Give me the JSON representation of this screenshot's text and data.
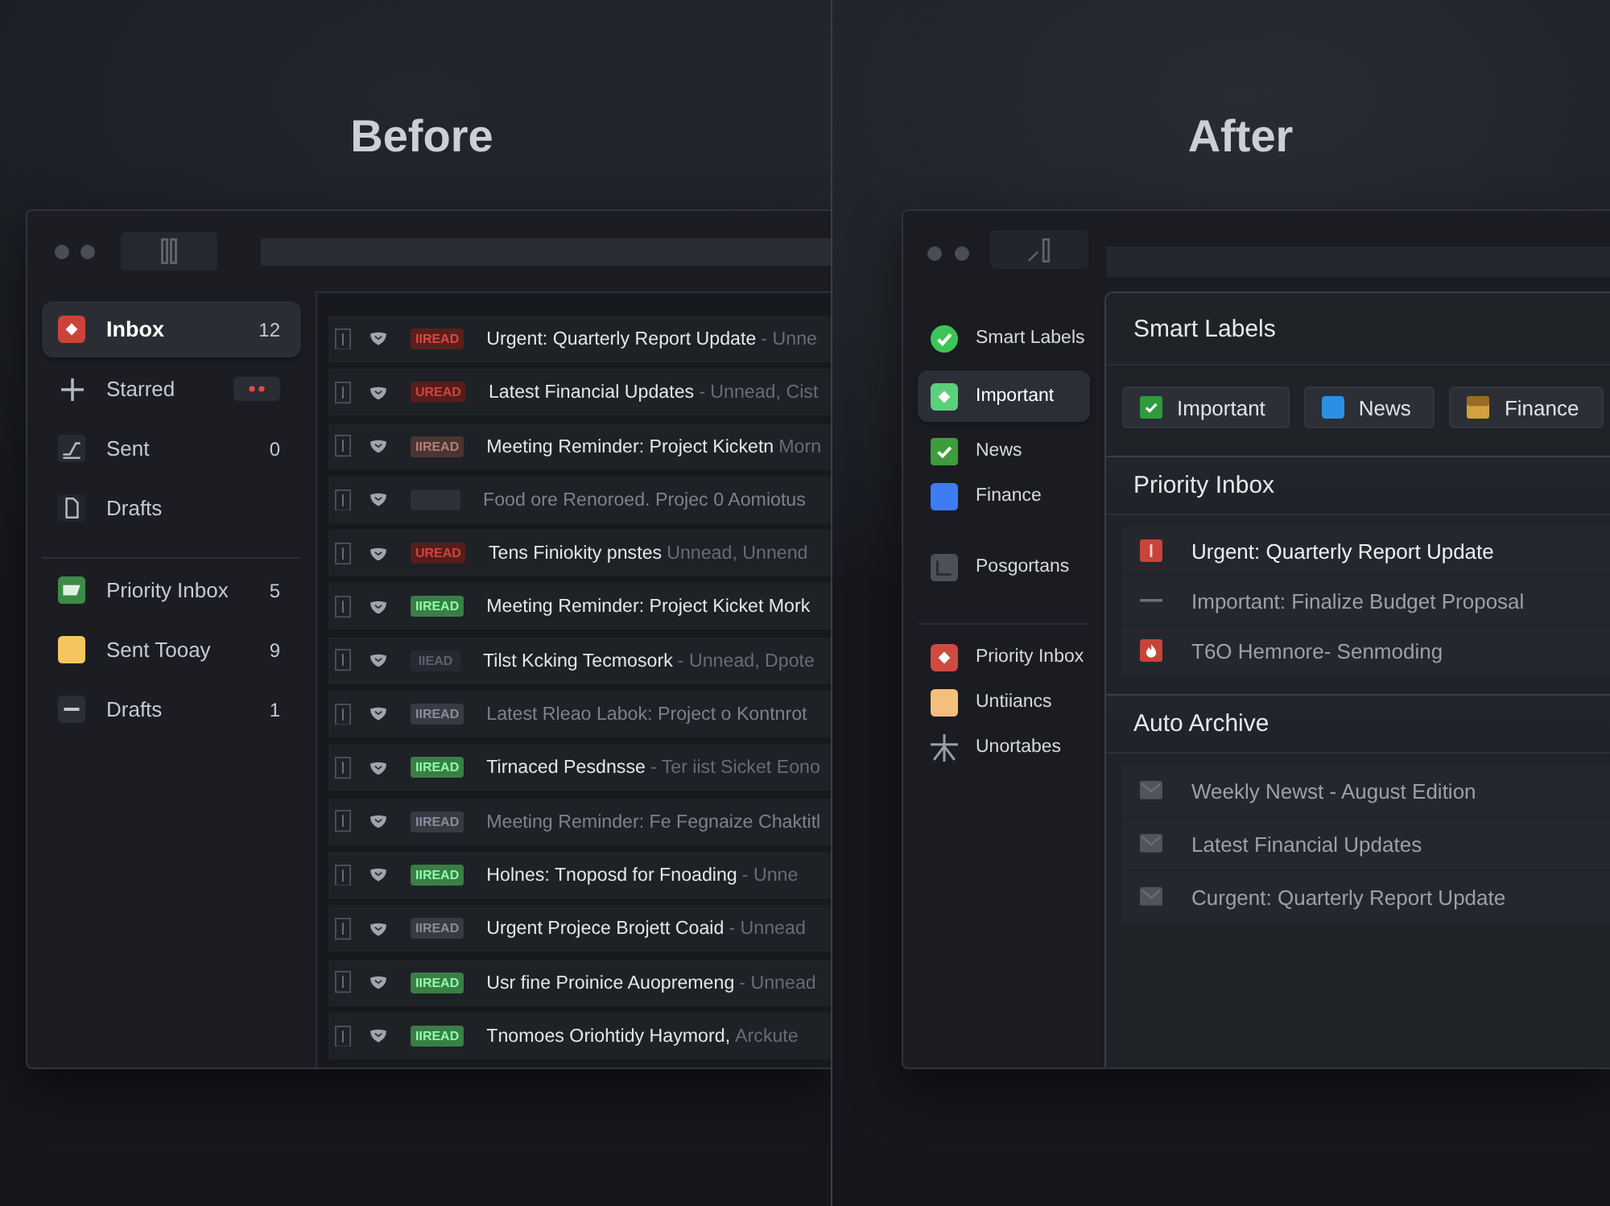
{
  "before": {
    "heading": "Before",
    "sidebar": {
      "folders": [
        {
          "label": "Inbox",
          "kind": "diamond",
          "count": "12",
          "marker": false,
          "selected": true
        },
        {
          "label": "Starred",
          "kind": "plus",
          "marker": true,
          "selected": false
        },
        {
          "label": "Sent",
          "kind": "trend",
          "count": "0",
          "marker": false,
          "selected": false
        },
        {
          "label": "Drafts",
          "kind": "document",
          "marker": false,
          "selected": false
        }
      ],
      "labels": [
        {
          "label": "Priority Inbox",
          "kind": "tag",
          "color": "#3e8b48",
          "count": "5"
        },
        {
          "label": "Sent Tooay",
          "kind": "square",
          "color": "#f6c65e",
          "count": "9"
        },
        {
          "label": "Drafts",
          "kind": "minus",
          "color": "#2b2e35",
          "count": "1"
        }
      ]
    },
    "messages": [
      {
        "badge": {
          "text": "IIREAD",
          "color": "#5a1f1c"
        },
        "subject": "Urgent: Quarterly Report Update",
        "snippet": "- Unne",
        "dimmed": false
      },
      {
        "badge": {
          "text": "UREAD",
          "color": "#561d1a"
        },
        "subject": "Latest Financial Updates",
        "snippet": "- Unnead, Cist",
        "dimmed": false
      },
      {
        "badge": {
          "text": "IIREAD",
          "color": "#4a3531"
        },
        "subject": "Meeting Reminder: Project Kicketn",
        "snippet": "Morn",
        "dimmed": false
      },
      {
        "badge": {
          "color": "#2d3037"
        },
        "subject": "Food ore Renoroed. Projec 0 Aomiotus",
        "dimmed": true
      },
      {
        "badge": {
          "text": "UREAD",
          "color": "#561d1a"
        },
        "subject": "Tens Finiokity pnstes",
        "snippet": "Unnead, Unnend",
        "dimmed": false
      },
      {
        "badge": {
          "text": "IIREAD",
          "color": "#3a7e46"
        },
        "subject": "Meeting Reminder: Project Kicket Mork",
        "dimmed": false
      },
      {
        "badge": {
          "text": "IIEAD",
          "color": "#262930"
        },
        "subject": "Tilst Kcking Tecmosork",
        "snippet": "- Unnead, Dpote",
        "dimmed": false
      },
      {
        "badge": {
          "text": "IIREAD",
          "color": "#383b42"
        },
        "subject": "Latest Rleao Labok: Project o Kontnrot",
        "dimmed": true
      },
      {
        "badge": {
          "text": "IIREAD",
          "color": "#3a7e46"
        },
        "subject": "Tirnaced Pesdnsse",
        "snippet": "- Ter iist Sicket Eono",
        "dimmed": false
      },
      {
        "badge": {
          "text": "IIREAD",
          "color": "#383b42"
        },
        "subject": "Meeting Reminder: Fe Fegnaize Chaktitl",
        "dimmed": true
      },
      {
        "badge": {
          "text": "IIREAD",
          "color": "#3a7e46"
        },
        "subject": "Holnes: Tnoposd for Fnoading",
        "snippet": "- Unne",
        "dimmed": false
      },
      {
        "badge": {
          "text": "IIREAD",
          "color": "#383b42"
        },
        "subject": "Urgent Projece Brojett Coaid",
        "snippet": "- Unnead",
        "dimmed": false
      },
      {
        "badge": {
          "text": "IIREAD",
          "color": "#3a7e46"
        },
        "subject": "Usr fine Proinice Auopremeng",
        "snippet": "- Unnead",
        "dimmed": false
      },
      {
        "badge": {
          "text": "IIREAD",
          "color": "#3a7e46"
        },
        "subject": "Tnomoes Oriohtidy Haymord,",
        "snippet": "Arckute",
        "dimmed": false
      }
    ]
  },
  "after": {
    "heading": "After",
    "sidebar": {
      "items": [
        {
          "label": "Smart Labels",
          "kind": "check-circle",
          "color": "#3dc456",
          "selected": false
        },
        {
          "label": "Important",
          "kind": "diamond",
          "color": "#5ccf7c",
          "selected": true
        },
        {
          "label": "News",
          "kind": "check-square",
          "color": "#3f9c3c",
          "selected": false
        },
        {
          "label": "Finance",
          "kind": "square",
          "color": "#3d7cf2",
          "selected": false
        },
        {
          "label": "Posgortans",
          "kind": "tile",
          "color": "#4c5059",
          "selected": false
        }
      ],
      "labels": [
        {
          "label": "Priority Inbox",
          "kind": "diamond",
          "color": "#cf4a40"
        },
        {
          "label": "Untiiancs",
          "kind": "square",
          "color": "#f2bf7c"
        },
        {
          "label": "Unortabes",
          "kind": "asterisk",
          "color": "#9a9ea8"
        }
      ]
    },
    "sections": [
      {
        "kind": "chips",
        "title": "Smart Labels",
        "chips": [
          {
            "label": "Important",
            "kind": "check-square",
            "color": "#2f9b3c"
          },
          {
            "label": "News",
            "kind": "square",
            "color": "#2a90e4"
          },
          {
            "label": "Finance",
            "kind": "split",
            "color": "#d4a040"
          }
        ]
      },
      {
        "kind": "list",
        "title": "Priority Inbox",
        "rows": [
          {
            "subject": "Urgent: Quarterly Report Update",
            "kind": "alert",
            "dimmed": false
          },
          {
            "subject": "Important: Finalize Budget Proposal",
            "kind": "dash",
            "dimmed": true
          },
          {
            "subject": "T6O Hemnore- Senmoding",
            "kind": "flame",
            "dimmed": true
          }
        ]
      },
      {
        "kind": "list",
        "title": "Auto Archive",
        "rows": [
          {
            "subject": "Weekly Newst - August Edition",
            "kind": "envelope",
            "dimmed": true
          },
          {
            "subject": "Latest Financial Updates",
            "kind": "envelope",
            "dimmed": true
          },
          {
            "subject": "Curgent: Quarterly Report Update",
            "kind": "envelope",
            "dimmed": true
          }
        ]
      }
    ]
  }
}
